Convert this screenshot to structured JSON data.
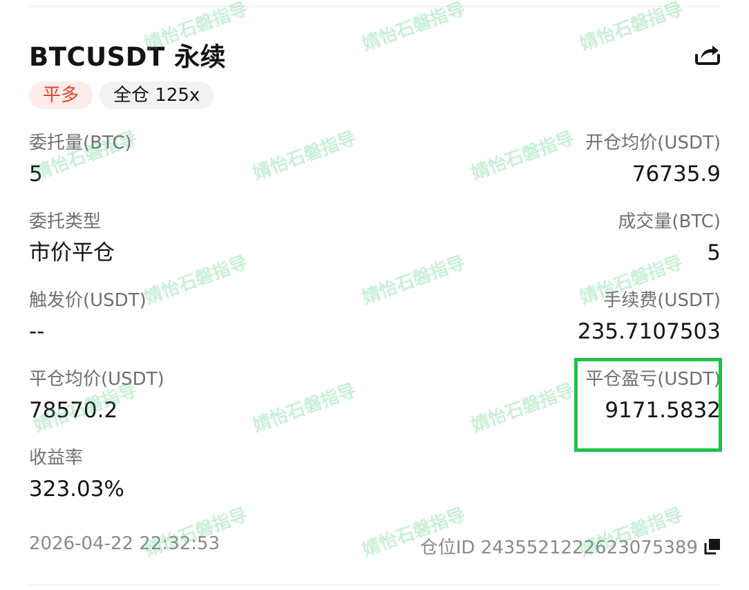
{
  "header": {
    "title": "BTCUSDT 永续",
    "side_tag": "平多",
    "margin_tag": "全仓 125x",
    "share_icon": "share-icon"
  },
  "fields": {
    "order_qty": {
      "label": "委托量(BTC)",
      "value": "5"
    },
    "open_avg_price": {
      "label": "开仓均价(USDT)",
      "value": "76735.9"
    },
    "order_type": {
      "label": "委托类型",
      "value": "市价平仓"
    },
    "filled_qty": {
      "label": "成交量(BTC)",
      "value": "5"
    },
    "trigger_price": {
      "label": "触发价(USDT)",
      "value": "--"
    },
    "fee": {
      "label": "手续费(USDT)",
      "value": "235.7107503"
    },
    "close_avg_price": {
      "label": "平仓均价(USDT)",
      "value": "78570.2"
    },
    "close_pnl": {
      "label": "平仓盈亏(USDT)",
      "value": "9171.5832"
    },
    "roi": {
      "label": "收益率",
      "value": "323.03%"
    }
  },
  "footer": {
    "timestamp": "2026-04-22 22:32:53",
    "position_id": "仓位ID 2435521222623075389",
    "copy_icon": "copy-icon"
  },
  "watermark_text": "婧怡石磐指导",
  "colors": {
    "side_tag_text": "#e0452e",
    "side_tag_bg": "#fdecea",
    "highlight": "#1ec24a",
    "label": "#6f6f6f"
  }
}
